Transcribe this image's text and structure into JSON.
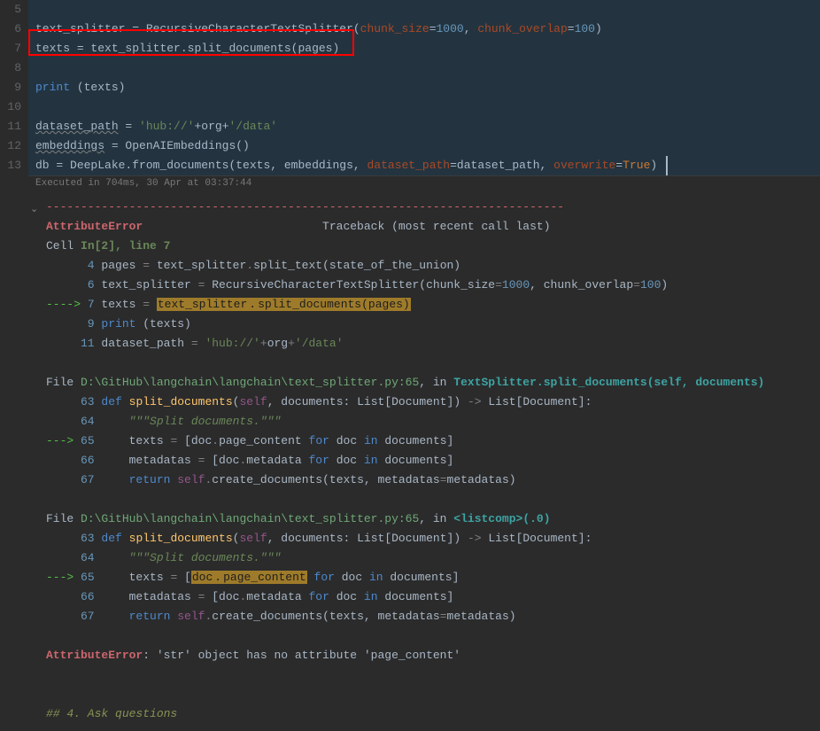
{
  "gutter": {
    "lines": [
      "5",
      "6",
      "7",
      "8",
      "9",
      "10",
      "11",
      "12",
      "13"
    ]
  },
  "code": {
    "l6": {
      "a": "text_splitter ",
      "b": "=",
      "c": " RecursiveCharacterTextSplitter(",
      "p1": "chunk_size",
      "eq1": "=",
      "n1": "1000",
      "cm": ", ",
      "p2": "chunk_overlap",
      "eq2": "=",
      "n2": "100",
      "end": ")"
    },
    "l7": {
      "a": "texts ",
      "b": "=",
      "c": " text_splitter.split_documents(pages)"
    },
    "l9": {
      "a": "print",
      "b": " (texts)"
    },
    "l11": {
      "a": "dataset_path",
      "eq": " = ",
      "s1": "'hub://'",
      "plus1": "+",
      "org": "org",
      "plus2": "+",
      "s2": "'/data'"
    },
    "l12": {
      "a": "embeddings",
      "eq": " = ",
      "call": "OpenAIEmbeddings()"
    },
    "l13": {
      "a": "db ",
      "eq": "=",
      "b": " DeepLake.from_documents(texts, embeddings, ",
      "p1": "dataset_path",
      "eq1": "=",
      "v1": "dataset_path, ",
      "p2": "overwrite",
      "eq2": "=",
      "tr": "True",
      "end": ")"
    }
  },
  "exec": {
    "text": "Executed in 704ms, 30 Apr at 03:37:44"
  },
  "out": {
    "sep": "---------------------------------------------------------------------------",
    "err": "AttributeError",
    "trace": "                          Traceback (most recent call last)",
    "cell_a": "Cell ",
    "cell_b": "In[2], line 7",
    "r4": {
      "n": "      4",
      "a": " pages ",
      "eq": "=",
      "b": " text_splitter",
      "dot": ".",
      "c": "split_text(state_of_the_union)"
    },
    "r6": {
      "n": "      6",
      "a": " text_splitter ",
      "eq": "=",
      "b": " RecursiveCharacterTextSplitter(chunk_size",
      "eq2": "=",
      "nn": "1000",
      "c": ", chunk_overlap",
      "eq3": "=",
      "nn2": "100",
      "end": ")"
    },
    "r7": {
      "arrow": "----> ",
      "n": "7",
      "a": " texts ",
      "eq": "=",
      "sp": " ",
      "hl": "text_splitter",
      "dot": ".",
      "hl2": "split_documents(pages)"
    },
    "r9": {
      "n": "      9",
      "sp": " ",
      "pr": "print",
      "b": " (texts)"
    },
    "r11": {
      "n": "     11",
      "a": " dataset_path ",
      "eq": "=",
      "sp": " ",
      "s1": "'hub://'",
      "plus": "+",
      "org": "org",
      "plus2": "+",
      "s2": "'/data'"
    },
    "file1": {
      "a": "File ",
      "path": "D:\\GitHub\\langchain\\langchain\\text_splitter.py:65",
      "b": ", in ",
      "fn": "TextSplitter.split_documents",
      "sig": "(self, documents)"
    },
    "d63": {
      "n": "     63",
      "sp": " ",
      "def": "def",
      "sp2": " ",
      "name": "split_documents",
      "sig_a": "(",
      "self": "self",
      "sig_b": ", documents: List[Document]) ",
      "arrow": "->",
      "ret": " List[Document]:"
    },
    "d64": {
      "n": "     64",
      "doc": "     \"\"\"Split documents.\"\"\""
    },
    "d65": {
      "arrow": "---> ",
      "n": "65",
      "a": "     texts ",
      "eq": "=",
      "b": " [doc",
      "dot": ".",
      "c": "page_content ",
      "for": "for",
      "d": " doc ",
      "in": "in",
      "e": " documents]"
    },
    "d66": {
      "n": "     66",
      "a": "     metadatas ",
      "eq": "=",
      "b": " [doc",
      "dot": ".",
      "c": "metadata ",
      "for": "for",
      "d": " doc ",
      "in": "in",
      "e": " documents]"
    },
    "d67": {
      "n": "     67",
      "a": "     ",
      "ret": "return",
      "sp": " ",
      "self": "self",
      "dot": ".",
      "call": "create_documents(texts, metadatas",
      "eq": "=",
      "m": "metadatas)"
    },
    "file2": {
      "a": "File ",
      "path": "D:\\GitHub\\langchain\\langchain\\text_splitter.py:65",
      "b": ", in ",
      "lc": "<listcomp>",
      "sig": "(.0)"
    },
    "e63": {
      "n": "     63",
      "sp": " ",
      "def": "def",
      "sp2": " ",
      "name": "split_documents",
      "sig_a": "(",
      "self": "self",
      "sig_b": ", documents: List[Document]) ",
      "arrow": "->",
      "ret": " List[Document]:"
    },
    "e64": {
      "n": "     64",
      "doc": "     \"\"\"Split documents.\"\"\""
    },
    "e65": {
      "arrow": "---> ",
      "n": "65",
      "a": "     texts ",
      "eq": "=",
      "b": " [",
      "hl": "doc",
      "dot": ".",
      "hl2": "page_content",
      "sp": " ",
      "for": "for",
      "d": " doc ",
      "in": "in",
      "e": " documents]"
    },
    "e66": {
      "n": "     66",
      "a": "     metadatas ",
      "eq": "=",
      "b": " [doc",
      "dot": ".",
      "c": "metadata ",
      "for": "for",
      "d": " doc ",
      "in": "in",
      "e": " documents]"
    },
    "e67": {
      "n": "     67",
      "a": "     ",
      "ret": "return",
      "sp": " ",
      "self": "self",
      "dot": ".",
      "call": "create_documents(texts, metadatas",
      "eq": "=",
      "m": "metadatas)"
    },
    "final_err": "AttributeError",
    "final_msg": ": 'str' object has no attribute 'page_content'",
    "md_heading": "## 4. Ask questions"
  }
}
